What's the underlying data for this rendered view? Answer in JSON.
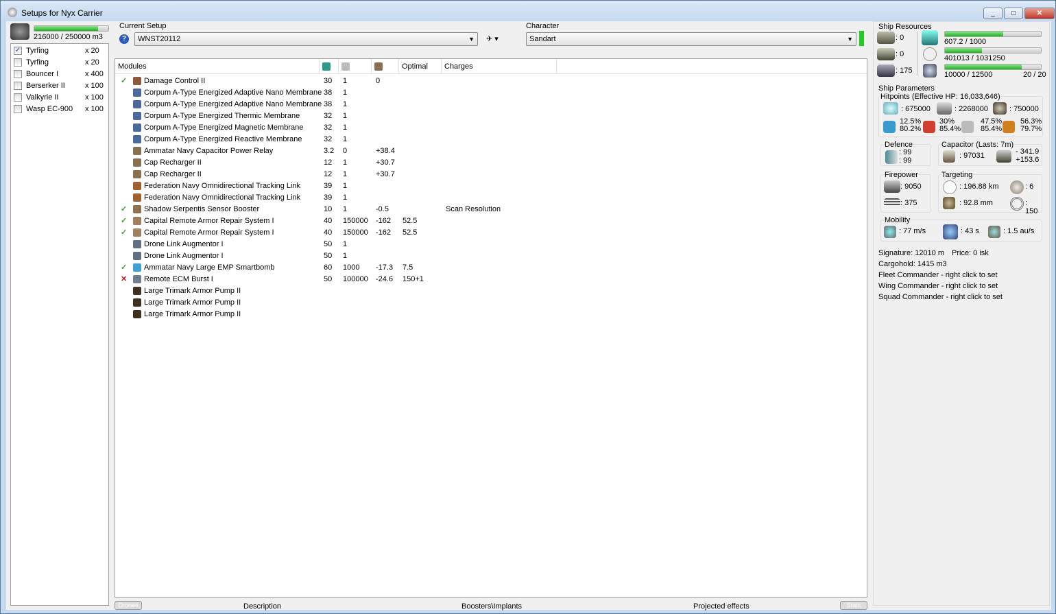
{
  "window": {
    "title": "Setups for Nyx Carrier",
    "buttons": [
      "minimize",
      "maximize",
      "close"
    ]
  },
  "drone_bay": {
    "capacity": "216000 / 250000 m3",
    "fill": 0.864,
    "drones": [
      {
        "name": "Tyrfing",
        "qty": "x 20",
        "checked": true
      },
      {
        "name": "Tyrfing",
        "qty": "x 20",
        "checked": false
      },
      {
        "name": "Bouncer I",
        "qty": "x 400",
        "checked": false
      },
      {
        "name": "Berserker II",
        "qty": "x 100",
        "checked": false
      },
      {
        "name": "Valkyrie II",
        "qty": "x 100",
        "checked": false
      },
      {
        "name": "Wasp EC-900",
        "qty": "x 100",
        "checked": false
      }
    ]
  },
  "setup": {
    "label": "Current Setup",
    "value": "WNST20112",
    "help_icon": "question-icon"
  },
  "character": {
    "label": "Character",
    "value": "Sandart",
    "status_color": "#22cc22"
  },
  "modules": {
    "columns": [
      "Modules",
      "cpu-icon",
      "powergrid-icon",
      "capacitor-icon",
      "Optimal",
      "Charges"
    ],
    "rows": [
      {
        "state": "ok",
        "name": "Damage Control II",
        "cpu": "30",
        "pg": "1",
        "cap": "0",
        "optimal": "",
        "charges": "",
        "icon": "#8a5a3a"
      },
      {
        "state": "",
        "name": "Corpum A-Type Energized Adaptive Nano Membrane",
        "cpu": "38",
        "pg": "1",
        "cap": "",
        "optimal": "",
        "charges": "",
        "icon": "#4a6a9a"
      },
      {
        "state": "",
        "name": "Corpum A-Type Energized Adaptive Nano Membrane",
        "cpu": "38",
        "pg": "1",
        "cap": "",
        "optimal": "",
        "charges": "",
        "icon": "#4a6a9a"
      },
      {
        "state": "",
        "name": "Corpum A-Type Energized Thermic Membrane",
        "cpu": "32",
        "pg": "1",
        "cap": "",
        "optimal": "",
        "charges": "",
        "icon": "#4a6a9a"
      },
      {
        "state": "",
        "name": "Corpum A-Type Energized Magnetic Membrane",
        "cpu": "32",
        "pg": "1",
        "cap": "",
        "optimal": "",
        "charges": "",
        "icon": "#4a6a9a"
      },
      {
        "state": "",
        "name": "Corpum A-Type Energized Reactive Membrane",
        "cpu": "32",
        "pg": "1",
        "cap": "",
        "optimal": "",
        "charges": "",
        "icon": "#4a6a9a"
      },
      {
        "state": "",
        "name": "Ammatar Navy Capacitor Power Relay",
        "cpu": "3.2",
        "pg": "0",
        "cap": "+38.4",
        "optimal": "",
        "charges": "",
        "icon": "#8a7050"
      },
      {
        "state": "",
        "name": "Cap Recharger II",
        "cpu": "12",
        "pg": "1",
        "cap": "+30.7",
        "optimal": "",
        "charges": "",
        "icon": "#8a7050"
      },
      {
        "state": "",
        "name": "Cap Recharger II",
        "cpu": "12",
        "pg": "1",
        "cap": "+30.7",
        "optimal": "",
        "charges": "",
        "icon": "#8a7050"
      },
      {
        "state": "",
        "name": "Federation Navy Omnidirectional Tracking Link",
        "cpu": "39",
        "pg": "1",
        "cap": "",
        "optimal": "",
        "charges": "",
        "icon": "#a06030"
      },
      {
        "state": "",
        "name": "Federation Navy Omnidirectional Tracking Link",
        "cpu": "39",
        "pg": "1",
        "cap": "",
        "optimal": "",
        "charges": "",
        "icon": "#a06030"
      },
      {
        "state": "ok",
        "name": "Shadow Serpentis Sensor Booster",
        "cpu": "10",
        "pg": "1",
        "cap": "-0.5",
        "optimal": "",
        "charges": "Scan Resolution",
        "icon": "#907050"
      },
      {
        "state": "ok",
        "name": "Capital Remote Armor Repair System I",
        "cpu": "40",
        "pg": "150000",
        "cap": "-162",
        "optimal": "52.5",
        "charges": "",
        "icon": "#a08060"
      },
      {
        "state": "ok",
        "name": "Capital Remote Armor Repair System I",
        "cpu": "40",
        "pg": "150000",
        "cap": "-162",
        "optimal": "52.5",
        "charges": "",
        "icon": "#a08060"
      },
      {
        "state": "",
        "name": "Drone Link Augmentor I",
        "cpu": "50",
        "pg": "1",
        "cap": "",
        "optimal": "",
        "charges": "",
        "icon": "#607080"
      },
      {
        "state": "",
        "name": "Drone Link Augmentor I",
        "cpu": "50",
        "pg": "1",
        "cap": "",
        "optimal": "",
        "charges": "",
        "icon": "#607080"
      },
      {
        "state": "ok",
        "name": "Ammatar Navy Large EMP Smartbomb",
        "cpu": "60",
        "pg": "1000",
        "cap": "-17.3",
        "optimal": "7.5",
        "charges": "",
        "icon": "#40a0d0"
      },
      {
        "state": "bad",
        "name": "Remote ECM Burst I",
        "cpu": "50",
        "pg": "100000",
        "cap": "-24.6",
        "optimal": "150+1",
        "charges": "",
        "icon": "#708090"
      },
      {
        "state": "",
        "name": "Large Trimark Armor Pump II",
        "cpu": "",
        "pg": "",
        "cap": "",
        "optimal": "",
        "charges": "",
        "icon": "#403020"
      },
      {
        "state": "",
        "name": "Large Trimark Armor Pump II",
        "cpu": "",
        "pg": "",
        "cap": "",
        "optimal": "",
        "charges": "",
        "icon": "#403020"
      },
      {
        "state": "",
        "name": "Large Trimark Armor Pump II",
        "cpu": "",
        "pg": "",
        "cap": "",
        "optimal": "",
        "charges": "",
        "icon": "#403020"
      }
    ]
  },
  "bottom_tabs": {
    "drones": "Drones",
    "description": "Description",
    "boosters": "Boosters\\Implants",
    "projected": "Projected effects",
    "stats": "Stats"
  },
  "resources": {
    "label": "Ship Resources",
    "turrets": ": 0",
    "launchers": ": 0",
    "calibration": ": 175",
    "cpu": "607.2 / 1000",
    "cpu_fill": 0.607,
    "powergrid": "401013 / 1031250",
    "powergrid_fill": 0.389,
    "drone_bandwidth": "10000 / 12500",
    "drone_fill": 0.8,
    "drones_active": "20 / 20"
  },
  "parameters": {
    "label": "Ship Parameters",
    "hitpoints": {
      "label": "Hitpoints (Effective HP: 16,033,646)",
      "shield": ": 675000",
      "armor": ": 2268000",
      "structure": ": 750000",
      "resists": [
        {
          "a": "12.5%",
          "b": "80.2%"
        },
        {
          "a": "30%",
          "b": "85.4%"
        },
        {
          "a": "47.5%",
          "b": "85.4%"
        },
        {
          "a": "56.3%",
          "b": "79.7%"
        }
      ]
    },
    "defence": {
      "label": "Defence",
      "a": ": 99",
      "b": ": 99"
    },
    "capacitor": {
      "label": "Capacitor (Lasts: 7m)",
      "amount": ": 97031",
      "use": "- 341.9",
      "recharge": "+153.6"
    },
    "firepower": {
      "label": "Firepower",
      "dps": ": 9050",
      "volley": ": 375"
    },
    "targeting": {
      "label": "Targeting",
      "range": ": 196.88 km",
      "targets": ": 6",
      "scan": ": 92.8 mm",
      "sensor": ": 150"
    },
    "mobility": {
      "label": "Mobility",
      "speed": ": 77 m/s",
      "align": ": 43 s",
      "warp": ": 1.5 au/s"
    }
  },
  "info": {
    "signature": "Signature: 12010 m",
    "price": "Price: 0 isk",
    "cargohold": "Cargohold: 1415 m3",
    "fleet": "Fleet Commander - right click to set",
    "wing": "Wing Commander - right click to set",
    "squad": "Squad Commander - right click to set"
  }
}
